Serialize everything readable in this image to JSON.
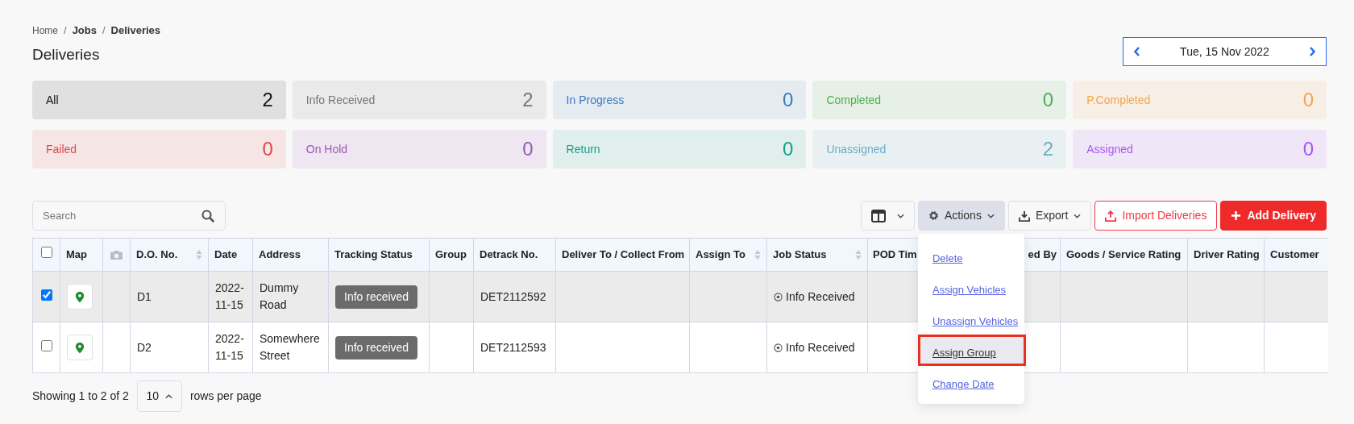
{
  "breadcrumb": [
    {
      "label": "Home",
      "separator": "/"
    },
    {
      "label": "Jobs",
      "separator": "/"
    },
    {
      "label": "Deliveries"
    }
  ],
  "title": "Deliveries",
  "date_nav": {
    "label": "Tue, 15 Nov 2022"
  },
  "status_cards": [
    {
      "label": "All",
      "count": "2",
      "color": "#111111"
    },
    {
      "label": "Info Received",
      "count": "2",
      "color": "#777777"
    },
    {
      "label": "In Progress",
      "count": "0",
      "color": "#3a7bbf"
    },
    {
      "label": "Completed",
      "count": "0",
      "color": "#4caf50"
    },
    {
      "label": "P.Completed",
      "count": "0",
      "color": "#f2a54a"
    },
    {
      "label": "Failed",
      "count": "0",
      "color": "#e04848"
    },
    {
      "label": "On Hold",
      "count": "0",
      "color": "#9b59b6"
    },
    {
      "label": "Return",
      "count": "0",
      "color": "#16a085"
    },
    {
      "label": "Unassigned",
      "count": "2",
      "color": "#6aaec4"
    },
    {
      "label": "Assigned",
      "count": "0",
      "color": "#a855f7"
    }
  ],
  "search": {
    "placeholder": "Search"
  },
  "toolbar": [
    {
      "kind": "columns",
      "expanded": false
    },
    {
      "kind": "actions",
      "label": "Actions",
      "expanded": true
    },
    {
      "kind": "export",
      "label": "Export",
      "expanded": false
    },
    {
      "kind": "import",
      "label": "Import Deliveries"
    },
    {
      "kind": "add",
      "label": "Add Delivery"
    }
  ],
  "actions_menu": [
    {
      "label": "Delete",
      "selected": false
    },
    {
      "label": "Assign Vehicles",
      "selected": false
    },
    {
      "label": "Unassign Vehicles",
      "selected": false
    },
    {
      "label": "Assign Group",
      "selected": true
    },
    {
      "label": "Change Date",
      "selected": false
    }
  ],
  "table": {
    "columns": [
      {
        "kind": "checkbox",
        "checked": false
      },
      {
        "kind": "text",
        "label": "Map",
        "sortable": false
      },
      {
        "kind": "camera"
      },
      {
        "kind": "text",
        "label": "D.O. No.",
        "sortable": true
      },
      {
        "kind": "text",
        "label": "Date",
        "sortable": false
      },
      {
        "kind": "text",
        "label": "Address",
        "sortable": false
      },
      {
        "kind": "text",
        "label": "Tracking Status",
        "sortable": false
      },
      {
        "kind": "text",
        "label": "Group",
        "sortable": false
      },
      {
        "kind": "text",
        "label": "Detrack No.",
        "sortable": false
      },
      {
        "kind": "text",
        "label": "Deliver To / Collect From",
        "sortable": false
      },
      {
        "kind": "text",
        "label": "Assign To",
        "sortable": true
      },
      {
        "kind": "text",
        "label": "Job Status",
        "sortable": true
      },
      {
        "kind": "text",
        "label": "POD Tim"
      },
      {
        "kind": "text",
        "label": "ed By"
      },
      {
        "kind": "text",
        "label": "Goods / Service Rating",
        "sortable": false
      },
      {
        "kind": "text",
        "label": "Driver Rating",
        "sortable": false
      },
      {
        "kind": "text",
        "label": "Customer",
        "sortable": false
      }
    ],
    "rows": [
      {
        "checked": true,
        "do_no": "D1",
        "date": "2022-11-15",
        "address": "Dummy Road",
        "tracking_status": "Info received",
        "detrack_no": "DET2112592",
        "job_status": "Info Received"
      },
      {
        "checked": false,
        "do_no": "D2",
        "date": "2022-11-15",
        "address": "Somewhere Street",
        "tracking_status": "Info received",
        "detrack_no": "DET2112593",
        "job_status": "Info Received"
      }
    ]
  },
  "pagination": {
    "summary": "Showing 1 to 2 of 2",
    "page_size": "10",
    "suffix": "rows per page"
  }
}
